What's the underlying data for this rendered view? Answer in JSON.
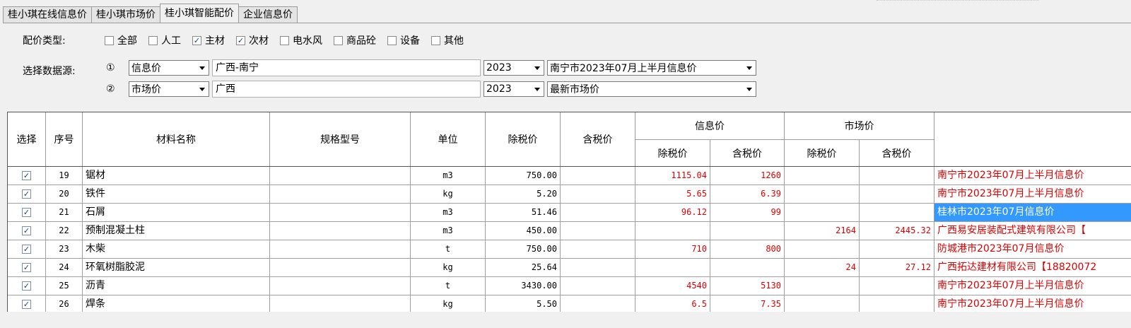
{
  "tabs": [
    "桂小琪在线信息价",
    "桂小琪市场价",
    "桂小琪智能配价",
    "企业信息价"
  ],
  "active_tab": 2,
  "price_type": {
    "label": "配价类型:",
    "options": [
      {
        "label": "全部",
        "checked": false
      },
      {
        "label": "人工",
        "checked": false
      },
      {
        "label": "主材",
        "checked": true
      },
      {
        "label": "次材",
        "checked": true
      },
      {
        "label": "电水风",
        "checked": false
      },
      {
        "label": "商品砼",
        "checked": false
      },
      {
        "label": "设备",
        "checked": false
      },
      {
        "label": "其他",
        "checked": false
      }
    ]
  },
  "source": {
    "label": "选择数据源:",
    "rows": [
      {
        "num": "①",
        "type": "信息价",
        "region": "广西-南宁",
        "year": "2023",
        "period": "南宁市2023年07月上半月信息价"
      },
      {
        "num": "②",
        "type": "市场价",
        "region": "广西",
        "year": "2023",
        "period": "最新市场价"
      }
    ]
  },
  "table": {
    "headers": {
      "select": "选择",
      "seq": "序号",
      "name": "材料名称",
      "spec": "规格型号",
      "unit": "单位",
      "ex_tax": "除税价",
      "in_tax": "含税价",
      "info_group": "信息价",
      "market_group": "市场价",
      "sub_ex": "除税价",
      "sub_in": "含税价"
    },
    "rows": [
      {
        "checked": true,
        "seq": "19",
        "name": "锯材",
        "spec": "",
        "unit": "m3",
        "ex": "750.00",
        "in": "",
        "info_ex": "1115.04",
        "info_in": "1260",
        "mkt_ex": "",
        "mkt_in": "",
        "src": "南宁市2023年07月上半月信息价",
        "src_selected": false
      },
      {
        "checked": true,
        "seq": "20",
        "name": "铁件",
        "spec": "",
        "unit": "kg",
        "ex": "5.20",
        "in": "",
        "info_ex": "5.65",
        "info_in": "6.39",
        "mkt_ex": "",
        "mkt_in": "",
        "src": "南宁市2023年07月上半月信息价",
        "src_selected": false
      },
      {
        "checked": true,
        "seq": "21",
        "name": "石屑",
        "spec": "",
        "unit": "m3",
        "ex": "51.46",
        "in": "",
        "info_ex": "96.12",
        "info_in": "99",
        "mkt_ex": "",
        "mkt_in": "",
        "src": "桂林市2023年07月信息价",
        "src_selected": true
      },
      {
        "checked": true,
        "seq": "22",
        "name": "预制混凝土柱",
        "spec": "",
        "unit": "m3",
        "ex": "450.00",
        "in": "",
        "info_ex": "",
        "info_in": "",
        "mkt_ex": "2164",
        "mkt_in": "2445.32",
        "src": "广西易安居装配式建筑有限公司【",
        "src_selected": false
      },
      {
        "checked": true,
        "seq": "23",
        "name": "木柴",
        "spec": "",
        "unit": "t",
        "ex": "750.00",
        "in": "",
        "info_ex": "710",
        "info_in": "800",
        "mkt_ex": "",
        "mkt_in": "",
        "src": "防城港市2023年07月信息价",
        "src_selected": false
      },
      {
        "checked": true,
        "seq": "24",
        "name": "环氧树脂胶泥",
        "spec": "",
        "unit": "kg",
        "ex": "25.64",
        "in": "",
        "info_ex": "",
        "info_in": "",
        "mkt_ex": "24",
        "mkt_in": "27.12",
        "src": "广西拓达建材有限公司【18820072",
        "src_selected": false
      },
      {
        "checked": true,
        "seq": "25",
        "name": "沥青",
        "spec": "",
        "unit": "t",
        "ex": "3430.00",
        "in": "",
        "info_ex": "4540",
        "info_in": "5130",
        "mkt_ex": "",
        "mkt_in": "",
        "src": "南宁市2023年07月上半月信息价",
        "src_selected": false
      },
      {
        "checked": true,
        "seq": "26",
        "name": "焊条",
        "spec": "",
        "unit": "kg",
        "ex": "5.50",
        "in": "",
        "info_ex": "6.5",
        "info_in": "7.35",
        "mkt_ex": "",
        "mkt_in": "",
        "src": "南宁市2023年07月上半月信息价",
        "src_selected": false
      }
    ]
  },
  "colors": {
    "accent_red": "#e00000",
    "selection_blue": "#3399ff"
  }
}
